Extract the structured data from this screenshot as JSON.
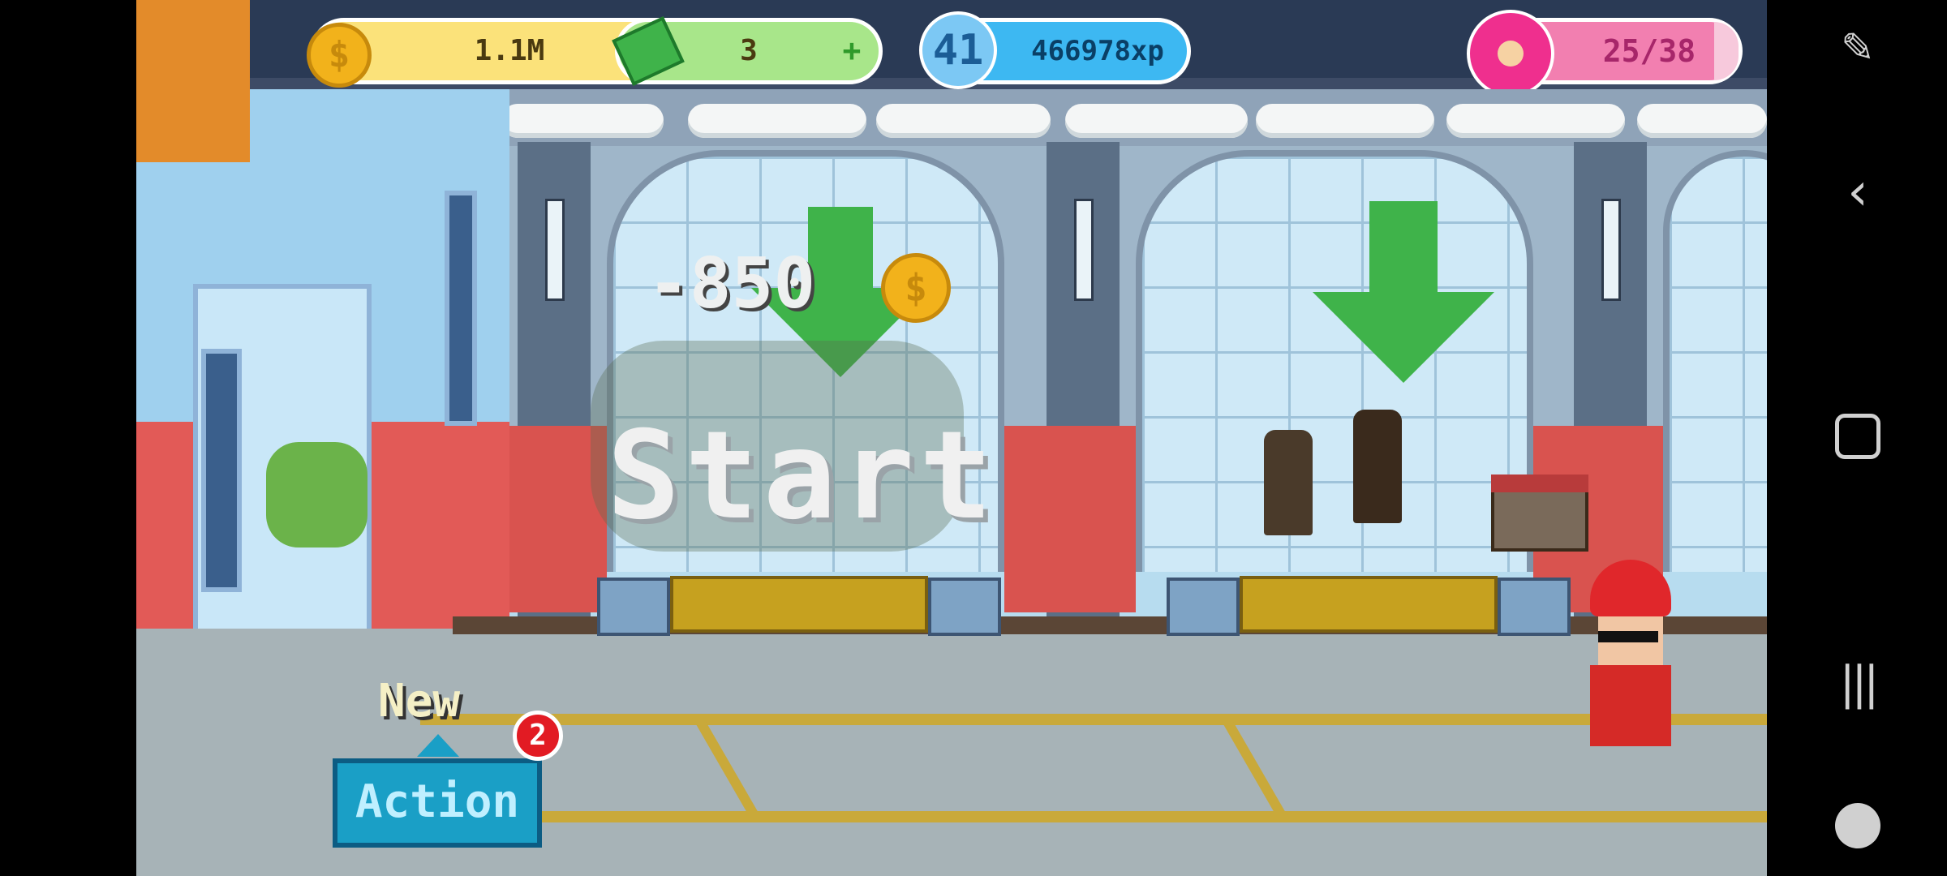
{
  "hud": {
    "coins": "1.1M",
    "cash": "3",
    "level": "41",
    "xp": "466978xp",
    "donuts": "25/38",
    "coin_icon": "coin-icon",
    "cash_icon": "cash-icon",
    "donut_icon": "donut-icon"
  },
  "scene": {
    "cost_label": "-850",
    "start_label": "Start"
  },
  "actions": {
    "new_label": "New",
    "action_label": "Action",
    "notification_count": "2"
  },
  "colors": {
    "coin_bar": "#fbe27a",
    "cash_bar": "#a8e68a",
    "xp_bar": "#3db8f2",
    "donut_bar": "#f27fb0",
    "action_button": "#1a9fc6"
  },
  "system_nav": [
    "screenshot-tool-icon",
    "back-icon",
    "home-icon",
    "recents-icon",
    "game-controller-icon"
  ]
}
